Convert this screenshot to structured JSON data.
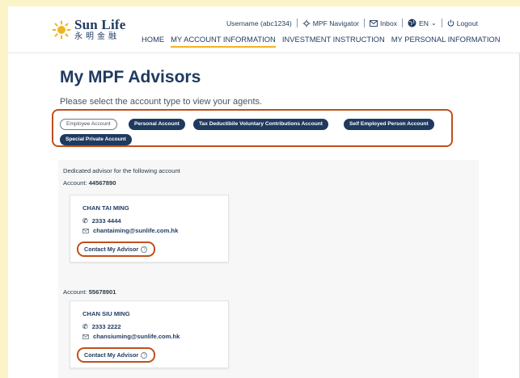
{
  "brand": {
    "name": "Sun Life",
    "chinese_name": "永明金融"
  },
  "utility": {
    "username": "Username (abc1234)",
    "navigator": "MPF Navigator",
    "inbox": "Inbox",
    "language": "EN",
    "logout": "Logout"
  },
  "nav": {
    "items": [
      "HOME",
      "MY ACCOUNT INFORMATION",
      "INVESTMENT INSTRUCTION",
      "MY PERSONAL INFORMATION"
    ],
    "active": "MY ACCOUNT INFORMATION"
  },
  "page": {
    "title": "My MPF Advisors",
    "subtitle": "Please select the account type to view your agents."
  },
  "account_types": {
    "selected": "Employee Account",
    "options": [
      "Employee Account",
      "Personal Account",
      "Tax Deductibile Voluntary Contributions Account",
      "Self Employed Person Account",
      "Special Private Account"
    ]
  },
  "advisors": {
    "intro": "Dedicated advisor for the following account",
    "account_label": "Account:",
    "contact_label": "Contact My Advisor",
    "list": [
      {
        "account": "44567890",
        "name": "CHAN TAI MING",
        "phone": "2333 4444",
        "email": "chantaiming@sunlife.com.hk"
      },
      {
        "account": "55678901",
        "name": "CHAN SIU MING",
        "phone": "2333 2222",
        "email": "chansiuming@sunlife.com.hk"
      }
    ]
  },
  "colors": {
    "navy": "#1f3a5f",
    "highlight": "#c0501c",
    "accent": "#f0b323"
  }
}
